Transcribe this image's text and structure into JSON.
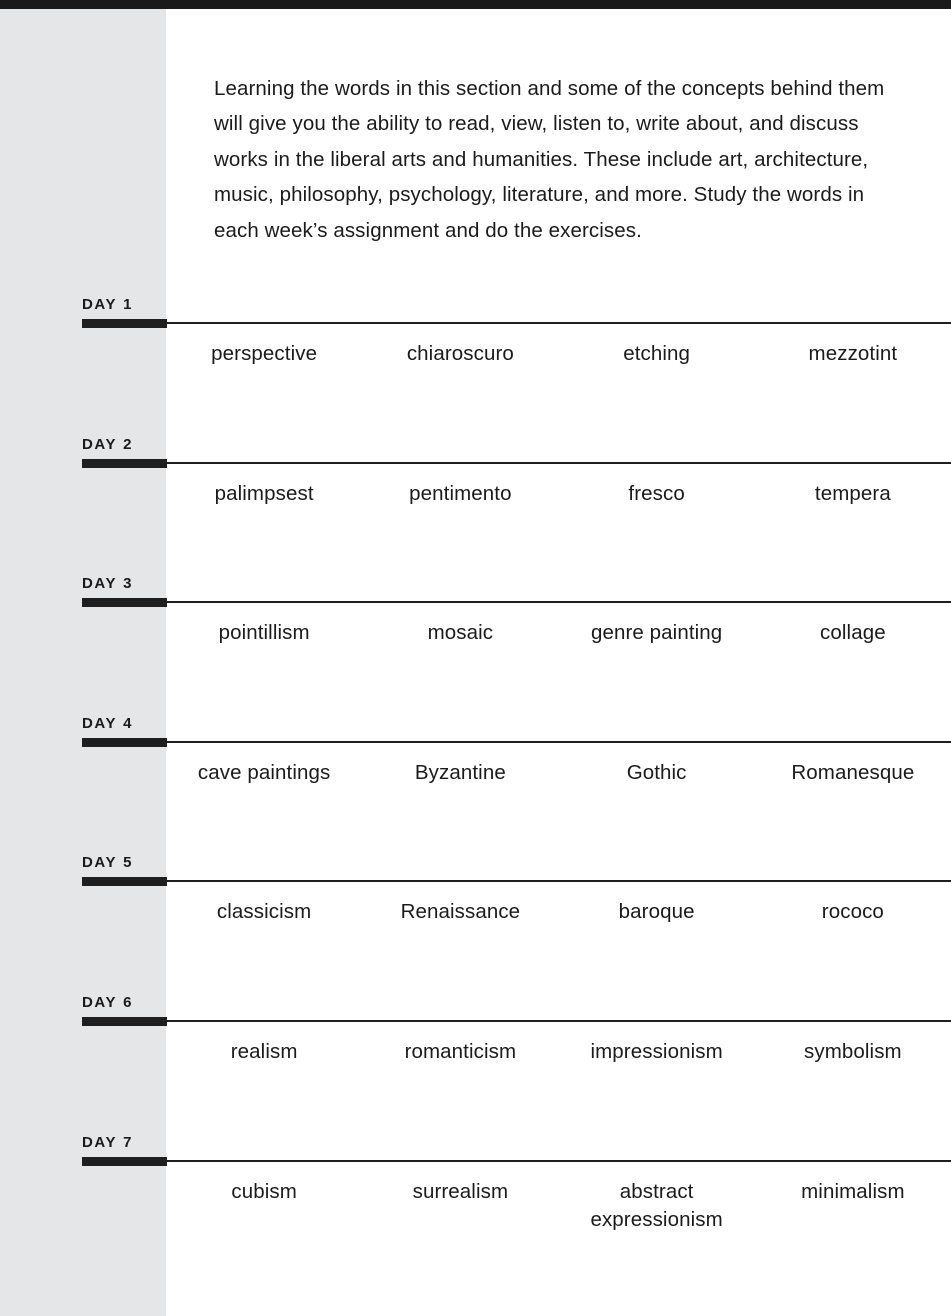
{
  "page": {
    "background_color": "#ffffff",
    "sidebar_color": "#e5e6e7",
    "rule_color": "#1a1a1a",
    "text_color": "#1b1b1b"
  },
  "intro": {
    "paragraph": "Learning the words in this section and some of the concepts behind them will give you the ability to read, view, listen to, write about, and discuss works in the liberal arts and humanities. These include art, architecture, music, philosophy, psychology, literature, and more. Study the words in each week’s assignment and do the exercises."
  },
  "days": [
    {
      "label": "DAY",
      "number": "1",
      "words": [
        "perspective",
        "chiaroscuro",
        "etching",
        "mezzotint"
      ]
    },
    {
      "label": "DAY",
      "number": "2",
      "words": [
        "palimpsest",
        "pentimento",
        "fresco",
        "tempera"
      ]
    },
    {
      "label": "DAY",
      "number": "3",
      "words": [
        "pointillism",
        "mosaic",
        "genre painting",
        "collage"
      ]
    },
    {
      "label": "DAY",
      "number": "4",
      "words": [
        "cave paintings",
        "Byzantine",
        "Gothic",
        "Romanesque"
      ]
    },
    {
      "label": "DAY",
      "number": "5",
      "words": [
        "classicism",
        "Renaissance",
        "baroque",
        "rococo"
      ]
    },
    {
      "label": "DAY",
      "number": "6",
      "words": [
        "realism",
        "romanticism",
        "impressionism",
        "symbolism"
      ]
    },
    {
      "label": "DAY",
      "number": "7",
      "words": [
        "cubism",
        "surrealism",
        "abstract expressionism",
        "minimalism"
      ]
    }
  ]
}
